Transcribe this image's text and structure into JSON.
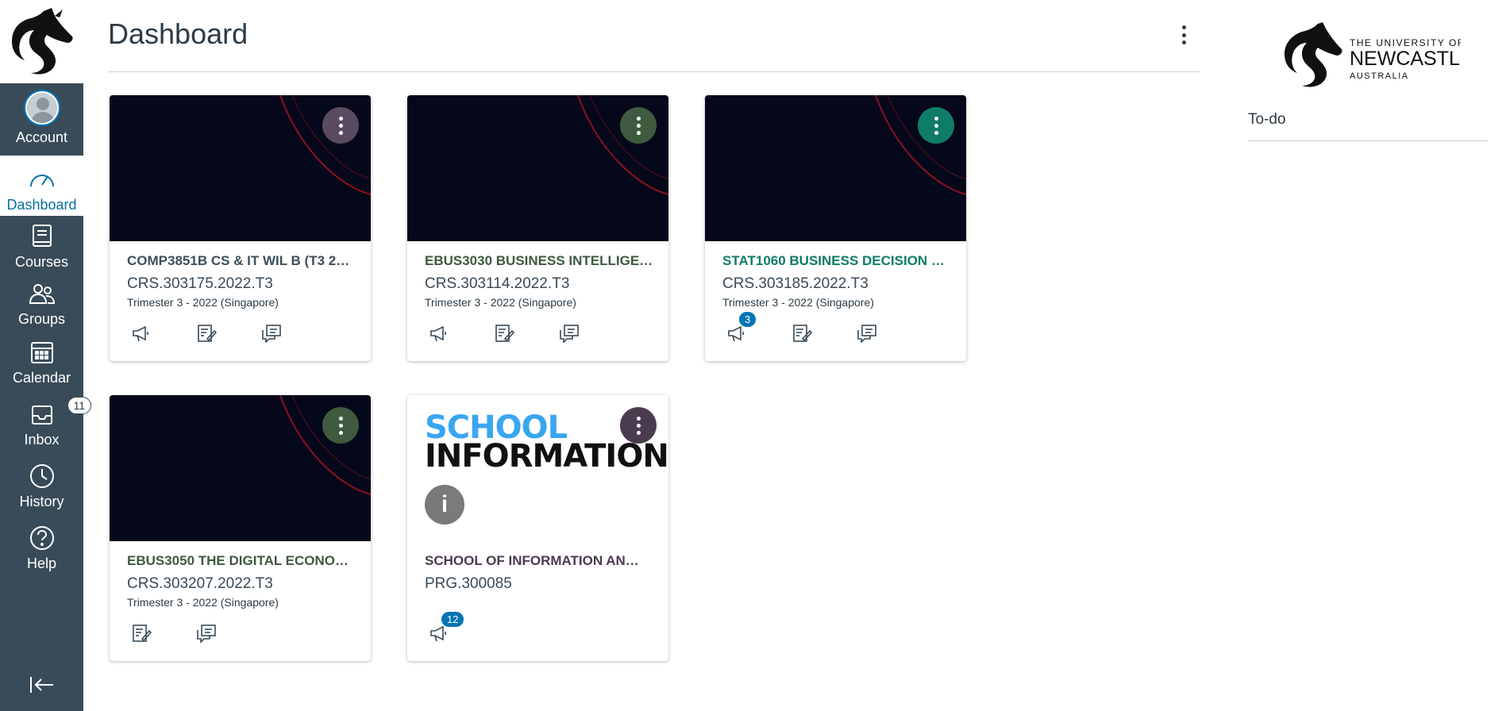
{
  "nav": {
    "account": "Account",
    "dashboard": "Dashboard",
    "courses": "Courses",
    "groups": "Groups",
    "calendar": "Calendar",
    "inbox": "Inbox",
    "inbox_badge": "11",
    "history": "History",
    "help": "Help",
    "collapse_icon": "collapse-left-icon"
  },
  "header": {
    "title": "Dashboard"
  },
  "cards": [
    {
      "title": "COMP3851B CS & IT WIL B (T3 2…",
      "code": "CRS.303175.2022.T3",
      "term": "Trimester 3 - 2022 (Singapore)",
      "color": "#5a4a5e",
      "title_color": "#3d4f5c"
    },
    {
      "title": "EBUS3030 BUSINESS INTELLIGE…",
      "code": "CRS.303114.2022.T3",
      "term": "Trimester 3 - 2022 (Singapore)",
      "color": "#3f5a3f",
      "title_color": "#3f5a3f"
    },
    {
      "title": "STAT1060 BUSINESS DECISION …",
      "code": "CRS.303185.2022.T3",
      "term": "Trimester 3 - 2022 (Singapore)",
      "color": "#0e7c66",
      "title_color": "#0e7c66",
      "announcements_badge": "3"
    },
    {
      "title": "EBUS3050 THE DIGITAL ECONO…",
      "code": "CRS.303207.2022.T3",
      "term": "Trimester 3 - 2022 (Singapore)",
      "color": "#3f5a3f",
      "title_color": "#3f5a3f"
    },
    {
      "title": "SCHOOL OF INFORMATION AN…",
      "code": "PRG.300085",
      "color": "#4b3b4f",
      "title_color": "#4b3b4f",
      "announcements_badge": "12",
      "hero_line1": "SCHOOL",
      "hero_line2": "INFORMATION"
    }
  ],
  "sidebar": {
    "logo_line1": "THE UNIVERSITY OF",
    "logo_line2": "NEWCASTLE",
    "logo_line3": "AUSTRALIA",
    "todo": "To-do"
  }
}
